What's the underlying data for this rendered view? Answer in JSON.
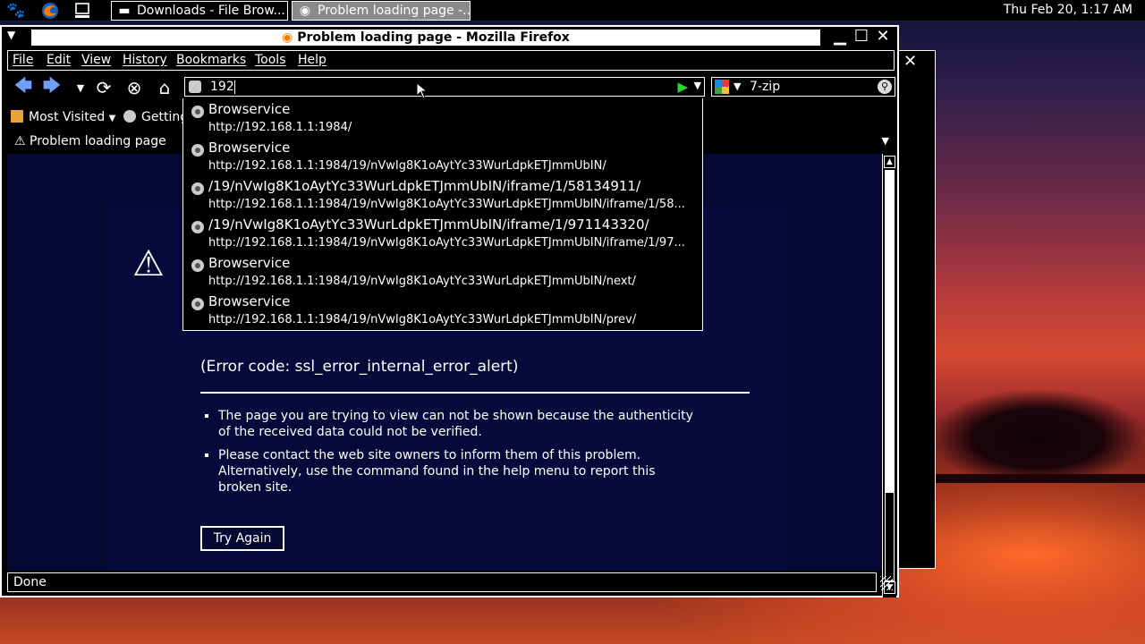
{
  "panel": {
    "clock": "Thu Feb 20,  1:17 AM",
    "launchers": [
      {
        "icon": "gnome-foot-icon"
      },
      {
        "icon": "firefox-icon"
      },
      {
        "icon": "computer-icon"
      }
    ],
    "tasks": [
      {
        "label": "Downloads - File Brow...",
        "icon": "folder-icon",
        "active": false
      },
      {
        "label": "Problem loading page -...",
        "icon": "firefox-icon",
        "active": true
      }
    ]
  },
  "window": {
    "title": "Problem loading page - Mozilla Firefox"
  },
  "menubar": {
    "items": [
      "File",
      "Edit",
      "View",
      "History",
      "Bookmarks",
      "Tools",
      "Help"
    ]
  },
  "navbar": {
    "url": "192",
    "search_text": "7-zip",
    "icons": [
      "back-icon",
      "forward-icon",
      "history-dropdown-icon",
      "reload-icon",
      "stop-icon",
      "home-icon"
    ]
  },
  "bookmarks": {
    "items": [
      "Most Visited",
      "Getting"
    ]
  },
  "tab": {
    "label": "Problem loading page"
  },
  "autocomplete": {
    "items": [
      {
        "title": "Browservice",
        "url": "http://192.168.1.1:1984/"
      },
      {
        "title": "Browservice",
        "url": "http://192.168.1.1:1984/19/nVwIg8K1oAytYc33WurLdpkETJmmUbIN/"
      },
      {
        "title": "/19/nVwIg8K1oAytYc33WurLdpkETJmmUbIN/iframe/1/58134911/",
        "url": "http://192.168.1.1:1984/19/nVwIg8K1oAytYc33WurLdpkETJmmUbIN/iframe/1/58..."
      },
      {
        "title": "/19/nVwIg8K1oAytYc33WurLdpkETJmmUbIN/iframe/1/971143320/",
        "url": "http://192.168.1.1:1984/19/nVwIg8K1oAytYc33WurLdpkETJmmUbIN/iframe/1/97..."
      },
      {
        "title": "Browservice",
        "url": "http://192.168.1.1:1984/19/nVwIg8K1oAytYc33WurLdpkETJmmUbIN/next/"
      },
      {
        "title": "Browservice",
        "url": "http://192.168.1.1:1984/19/nVwIg8K1oAytYc33WurLdpkETJmmUbIN/prev/"
      }
    ]
  },
  "error": {
    "code": "(Error code: ssl_error_internal_error_alert)",
    "bullets": [
      "The page you are trying to view can not be shown because the authenticity of the received data could not be verified.",
      "Please contact the web site owners to inform them of this problem. Alternatively, use the command found in the help menu to report this broken site."
    ],
    "try_again": "Try Again"
  },
  "status": {
    "text": "Done"
  },
  "colors": {
    "content_bg": "#050833",
    "go_arrow": "#2bd62b",
    "active_task": "#8a8a8a"
  }
}
